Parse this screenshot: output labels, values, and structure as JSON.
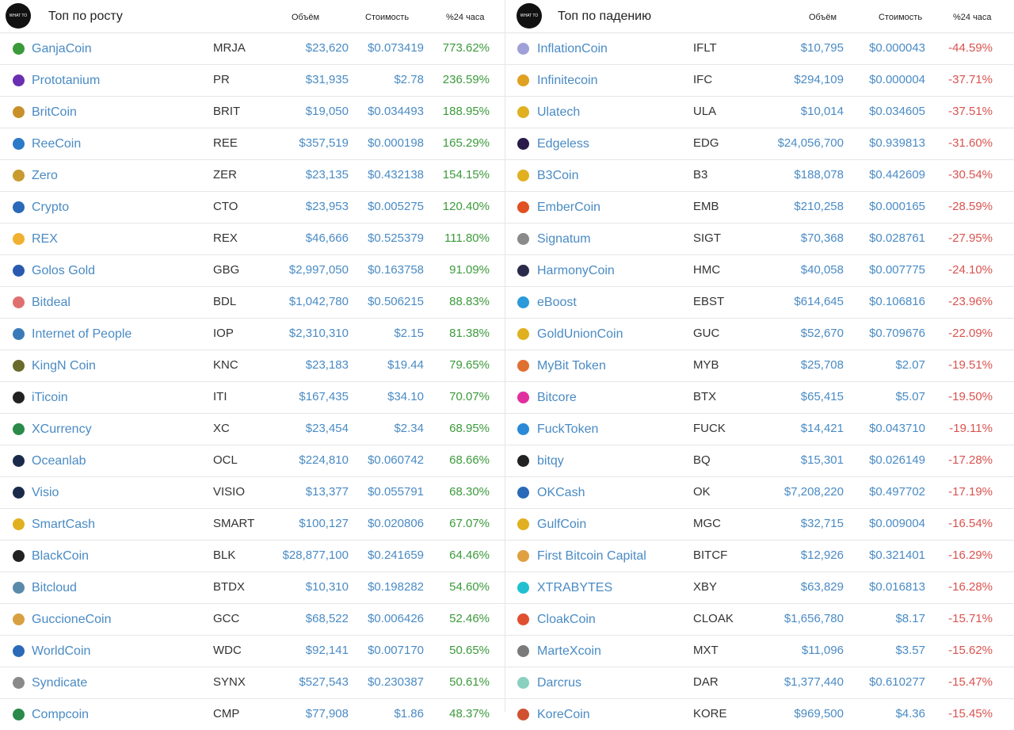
{
  "left": {
    "title": "Топ по росту",
    "columns": {
      "volume": "Объём",
      "price": "Стоимость",
      "change": "%24 часа"
    },
    "logo_text": "WHAT TO MINE",
    "rows": [
      {
        "name": "GanjaCoin",
        "symbol": "MRJA",
        "volume": "$23,620",
        "price": "$0.073419",
        "change": "773.62%",
        "icon": "leaf-icon",
        "color": "#3a9a3a"
      },
      {
        "name": "Prototanium",
        "symbol": "PR",
        "volume": "$31,935",
        "price": "$2.78",
        "change": "236.59%",
        "icon": "pr-icon",
        "color": "#6a2fb0"
      },
      {
        "name": "BritCoin",
        "symbol": "BRIT",
        "volume": "$19,050",
        "price": "$0.034493",
        "change": "188.95%",
        "icon": "castle-icon",
        "color": "#c8902a"
      },
      {
        "name": "ReeCoin",
        "symbol": "REE",
        "volume": "$357,519",
        "price": "$0.000198",
        "change": "165.29%",
        "icon": "ree-icon",
        "color": "#2a7ac8"
      },
      {
        "name": "Zero",
        "symbol": "ZER",
        "volume": "$23,135",
        "price": "$0.432138",
        "change": "154.15%",
        "icon": "zero-icon",
        "color": "#c89a30"
      },
      {
        "name": "Crypto",
        "symbol": "CTO",
        "volume": "$23,953",
        "price": "$0.005275",
        "change": "120.40%",
        "icon": "crypto-icon",
        "color": "#2a6ab8"
      },
      {
        "name": "REX",
        "symbol": "REX",
        "volume": "$46,666",
        "price": "$0.525379",
        "change": "111.80%",
        "icon": "rex-icon",
        "color": "#f0b030"
      },
      {
        "name": "Golos Gold",
        "symbol": "GBG",
        "volume": "$2,997,050",
        "price": "$0.163758",
        "change": "91.09%",
        "icon": "golos-icon",
        "color": "#2a5ab0"
      },
      {
        "name": "Bitdeal",
        "symbol": "BDL",
        "volume": "$1,042,780",
        "price": "$0.506215",
        "change": "88.83%",
        "icon": "bitdeal-icon",
        "color": "#e07070"
      },
      {
        "name": "Internet of People",
        "symbol": "IOP",
        "volume": "$2,310,310",
        "price": "$2.15",
        "change": "81.38%",
        "icon": "globe-icon",
        "color": "#3a7ab8"
      },
      {
        "name": "KingN Coin",
        "symbol": "KNC",
        "volume": "$23,183",
        "price": "$19.44",
        "change": "79.65%",
        "icon": "kingn-icon",
        "color": "#6a6a2a"
      },
      {
        "name": "iTicoin",
        "symbol": "ITI",
        "volume": "$167,435",
        "price": "$34.10",
        "change": "70.07%",
        "icon": "iticoin-icon",
        "color": "#222222"
      },
      {
        "name": "XCurrency",
        "symbol": "XC",
        "volume": "$23,454",
        "price": "$2.34",
        "change": "68.95%",
        "icon": "x-icon",
        "color": "#2a8a4a"
      },
      {
        "name": "Oceanlab",
        "symbol": "OCL",
        "volume": "$224,810",
        "price": "$0.060742",
        "change": "68.66%",
        "icon": "oceanlab-icon",
        "color": "#1a2a4a"
      },
      {
        "name": "Visio",
        "symbol": "VISIO",
        "volume": "$13,377",
        "price": "$0.055791",
        "change": "68.30%",
        "icon": "visio-icon",
        "color": "#1a2a4a"
      },
      {
        "name": "SmartCash",
        "symbol": "SMART",
        "volume": "$100,127",
        "price": "$0.020806",
        "change": "67.07%",
        "icon": "smartcash-icon",
        "color": "#e0b020"
      },
      {
        "name": "BlackCoin",
        "symbol": "BLK",
        "volume": "$28,877,100",
        "price": "$0.241659",
        "change": "64.46%",
        "icon": "blackcoin-icon",
        "color": "#222222"
      },
      {
        "name": "Bitcloud",
        "symbol": "BTDX",
        "volume": "$10,310",
        "price": "$0.198282",
        "change": "54.60%",
        "icon": "bitcloud-icon",
        "color": "#5a8aaa"
      },
      {
        "name": "GuccioneCoin",
        "symbol": "GCC",
        "volume": "$68,522",
        "price": "$0.006426",
        "change": "52.46%",
        "icon": "guccione-icon",
        "color": "#d8a040"
      },
      {
        "name": "WorldCoin",
        "symbol": "WDC",
        "volume": "$92,141",
        "price": "$0.007170",
        "change": "50.65%",
        "icon": "worldcoin-icon",
        "color": "#2a6ab8"
      },
      {
        "name": "Syndicate",
        "symbol": "SYNX",
        "volume": "$527,543",
        "price": "$0.230387",
        "change": "50.61%",
        "icon": "syndicate-icon",
        "color": "#8a8a8a"
      },
      {
        "name": "Compcoin",
        "symbol": "CMP",
        "volume": "$77,908",
        "price": "$1.86",
        "change": "48.37%",
        "icon": "compcoin-icon",
        "color": "#2a8a4a"
      }
    ]
  },
  "right": {
    "title": "Топ по падению",
    "columns": {
      "volume": "Объём",
      "price": "Стоимость",
      "change": "%24 часа"
    },
    "logo_text": "WHAT TO MINE",
    "rows": [
      {
        "name": "InflationCoin",
        "symbol": "IFLT",
        "volume": "$10,795",
        "price": "$0.000043",
        "change": "-44.59%",
        "icon": "inflation-icon",
        "color": "#a0a0d8"
      },
      {
        "name": "Infinitecoin",
        "symbol": "IFC",
        "volume": "$294,109",
        "price": "$0.000004",
        "change": "-37.71%",
        "icon": "infinite-icon",
        "color": "#e0a020"
      },
      {
        "name": "Ulatech",
        "symbol": "ULA",
        "volume": "$10,014",
        "price": "$0.034605",
        "change": "-37.51%",
        "icon": "ulatech-icon",
        "color": "#e0b020"
      },
      {
        "name": "Edgeless",
        "symbol": "EDG",
        "volume": "$24,056,700",
        "price": "$0.939813",
        "change": "-31.60%",
        "icon": "edgeless-icon",
        "color": "#2a1a4a"
      },
      {
        "name": "B3Coin",
        "symbol": "B3",
        "volume": "$188,078",
        "price": "$0.442609",
        "change": "-30.54%",
        "icon": "b3-icon",
        "color": "#e0b020"
      },
      {
        "name": "EmberCoin",
        "symbol": "EMB",
        "volume": "$210,258",
        "price": "$0.000165",
        "change": "-28.59%",
        "icon": "flame-icon",
        "color": "#e05020"
      },
      {
        "name": "Signatum",
        "symbol": "SIGT",
        "volume": "$70,368",
        "price": "$0.028761",
        "change": "-27.95%",
        "icon": "signatum-icon",
        "color": "#8a8a8a"
      },
      {
        "name": "HarmonyCoin",
        "symbol": "HMC",
        "volume": "$40,058",
        "price": "$0.007775",
        "change": "-24.10%",
        "icon": "harmony-icon",
        "color": "#2a2a4a"
      },
      {
        "name": "eBoost",
        "symbol": "EBST",
        "volume": "$614,645",
        "price": "$0.106816",
        "change": "-23.96%",
        "icon": "eboost-icon",
        "color": "#2a9ad8"
      },
      {
        "name": "GoldUnionCoin",
        "symbol": "GUC",
        "volume": "$52,670",
        "price": "$0.709676",
        "change": "-22.09%",
        "icon": "goldunion-icon",
        "color": "#e0b020"
      },
      {
        "name": "MyBit Token",
        "symbol": "MYB",
        "volume": "$25,708",
        "price": "$2.07",
        "change": "-19.51%",
        "icon": "mybit-icon",
        "color": "#e07030"
      },
      {
        "name": "Bitcore",
        "symbol": "BTX",
        "volume": "$65,415",
        "price": "$5.07",
        "change": "-19.50%",
        "icon": "bitcore-icon",
        "color": "#e030a0"
      },
      {
        "name": "FuckToken",
        "symbol": "FUCK",
        "volume": "$14,421",
        "price": "$0.043710",
        "change": "-19.11%",
        "icon": "fucktoken-icon",
        "color": "#2a8ad8"
      },
      {
        "name": "bitqy",
        "symbol": "BQ",
        "volume": "$15,301",
        "price": "$0.026149",
        "change": "-17.28%",
        "icon": "bitqy-icon",
        "color": "#222222"
      },
      {
        "name": "OKCash",
        "symbol": "OK",
        "volume": "$7,208,220",
        "price": "$0.497702",
        "change": "-17.19%",
        "icon": "okcash-icon",
        "color": "#2a6ab8"
      },
      {
        "name": "GulfCoin",
        "symbol": "MGC",
        "volume": "$32,715",
        "price": "$0.009004",
        "change": "-16.54%",
        "icon": "gulfcoin-icon",
        "color": "#e0b020"
      },
      {
        "name": "First Bitcoin Capital",
        "symbol": "BITCF",
        "volume": "$12,926",
        "price": "$0.321401",
        "change": "-16.29%",
        "icon": "fbc-icon",
        "color": "#e0a040"
      },
      {
        "name": "XTRABYTES",
        "symbol": "XBY",
        "volume": "$63,829",
        "price": "$0.016813",
        "change": "-16.28%",
        "icon": "xtrabytes-icon",
        "color": "#20c0d0"
      },
      {
        "name": "CloakCoin",
        "symbol": "CLOAK",
        "volume": "$1,656,780",
        "price": "$8.17",
        "change": "-15.71%",
        "icon": "cloak-icon",
        "color": "#e05030"
      },
      {
        "name": "MarteXcoin",
        "symbol": "MXT",
        "volume": "$11,096",
        "price": "$3.57",
        "change": "-15.62%",
        "icon": "martex-icon",
        "color": "#7a7a7a"
      },
      {
        "name": "Darcrus",
        "symbol": "DAR",
        "volume": "$1,377,440",
        "price": "$0.610277",
        "change": "-15.47%",
        "icon": "darcrus-icon",
        "color": "#8ad0c0"
      },
      {
        "name": "KoreCoin",
        "symbol": "KORE",
        "volume": "$969,500",
        "price": "$4.36",
        "change": "-15.45%",
        "icon": "korecoin-icon",
        "color": "#d05030"
      }
    ]
  }
}
